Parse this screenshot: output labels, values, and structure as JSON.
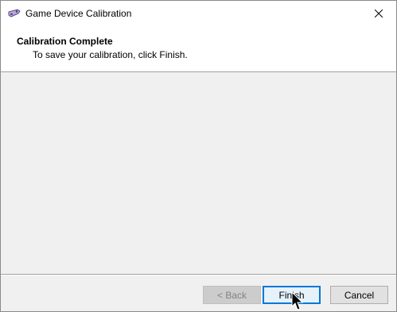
{
  "window": {
    "title": "Game Device Calibration",
    "icon": "game-controller-icon"
  },
  "header": {
    "title": "Calibration Complete",
    "subtitle": "To save your calibration, click Finish."
  },
  "buttons": {
    "back": "< Back",
    "finish": "Finish",
    "cancel": "Cancel"
  },
  "colors": {
    "accent": "#0078d7",
    "face": "#f0f0f0"
  }
}
